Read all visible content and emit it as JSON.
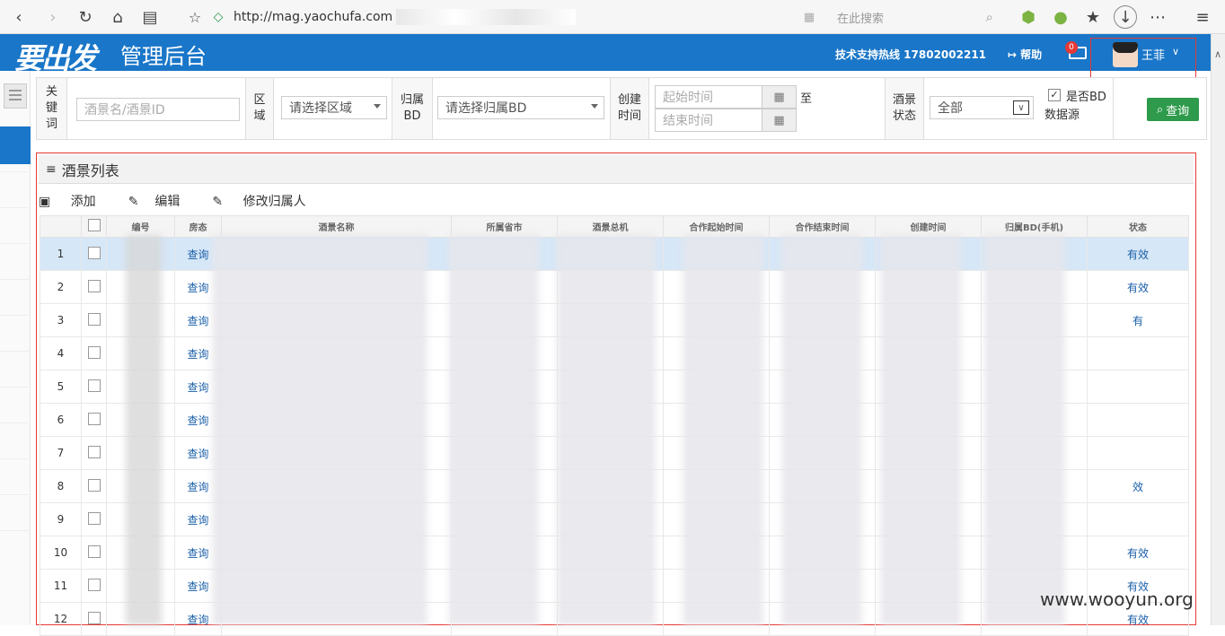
{
  "browser": {
    "url": "http://mag.yaochufa.com",
    "search_placeholder": "在此搜索"
  },
  "header": {
    "logo": "要出发",
    "title": "管理后台",
    "subtitle": "",
    "hotline": "技术支持热线 17802002211",
    "help": "帮助",
    "mail_count": "0",
    "user_name": "王菲"
  },
  "filters": {
    "keyword_label": "关键词",
    "keyword_placeholder": "酒景名/酒景ID",
    "region_label": "区域",
    "region_value": "请选择区域",
    "bd_label": "归属BD",
    "bd_value": "请选择归属BD",
    "created_label": "创建时间",
    "start_placeholder": "起始时间",
    "end_placeholder": "结束时间",
    "to": "至",
    "status_label": "酒景状态",
    "status_value": "全部",
    "bd_source_label": "是否BD数据源",
    "search_button": "查询"
  },
  "panel": {
    "title": "酒景列表",
    "add": "添加",
    "edit": "编辑",
    "change_owner": "修改归属人"
  },
  "table": {
    "headers": [
      "编号",
      "房态",
      "酒景名称",
      "所属省市",
      "酒景总机",
      "合作起始时间",
      "合作结束时间",
      "创建时间",
      "归属BD(手机)",
      "状态"
    ],
    "rows": [
      {
        "n": "1",
        "q": "查询",
        "s": "有效"
      },
      {
        "n": "2",
        "q": "查询",
        "s": "有效"
      },
      {
        "n": "3",
        "q": "查询",
        "s": "有"
      },
      {
        "n": "4",
        "q": "查询",
        "s": ""
      },
      {
        "n": "5",
        "q": "查询",
        "s": ""
      },
      {
        "n": "6",
        "q": "查询",
        "s": ""
      },
      {
        "n": "7",
        "q": "查询",
        "s": ""
      },
      {
        "n": "8",
        "q": "查询",
        "s": "效"
      },
      {
        "n": "9",
        "q": "查询",
        "s": ""
      },
      {
        "n": "10",
        "q": "查询",
        "s": "有效"
      },
      {
        "n": "11",
        "q": "查询",
        "s": "有效"
      },
      {
        "n": "12",
        "q": "查询",
        "s": "有效"
      }
    ]
  },
  "watermark": "www.wooyun.org"
}
